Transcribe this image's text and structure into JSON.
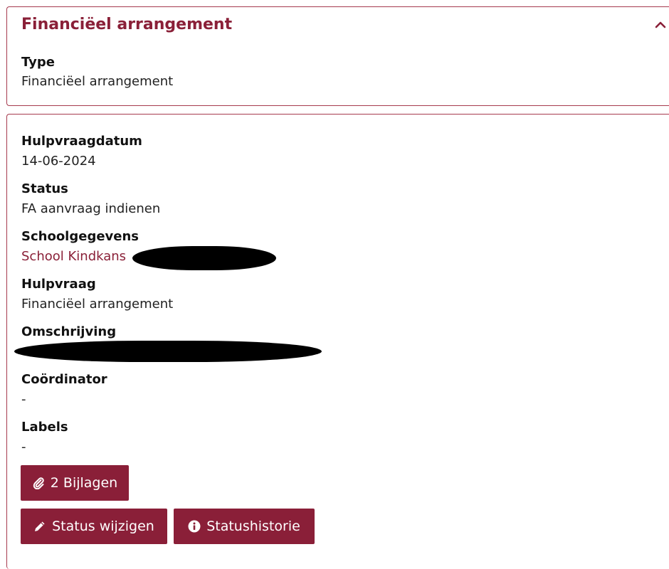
{
  "summary_panel": {
    "title": "Financiëel arrangement",
    "type_label": "Type",
    "type_value": "Financiëel arrangement"
  },
  "details": {
    "hulpvraagdatum_label": "Hulpvraagdatum",
    "hulpvraagdatum_value": "14-06-2024",
    "status_label": "Status",
    "status_value": "FA aanvraag indienen",
    "schoolgegevens_label": "Schoolgegevens",
    "schoolgegevens_value": "School Kindkans",
    "hulpvraag_label": "Hulpvraag",
    "hulpvraag_value": "Financiëel arrangement",
    "omschrijving_label": "Omschrijving",
    "coordinator_label": "Coördinator",
    "coordinator_value": "-",
    "labels_label": "Labels",
    "labels_value": "-"
  },
  "buttons": {
    "attachments_label": "2 Bijlagen",
    "change_status_label": "Status wijzigen",
    "status_history_label": "Statushistorie"
  },
  "icons": {
    "collapse": "chevron-up-icon",
    "attachments": "paperclip-icon",
    "change_status": "pencil-icon",
    "status_history": "info-circle-icon"
  },
  "colors": {
    "accent": "#8a1f38",
    "border": "#a63a4e",
    "title": "#8a2038"
  }
}
